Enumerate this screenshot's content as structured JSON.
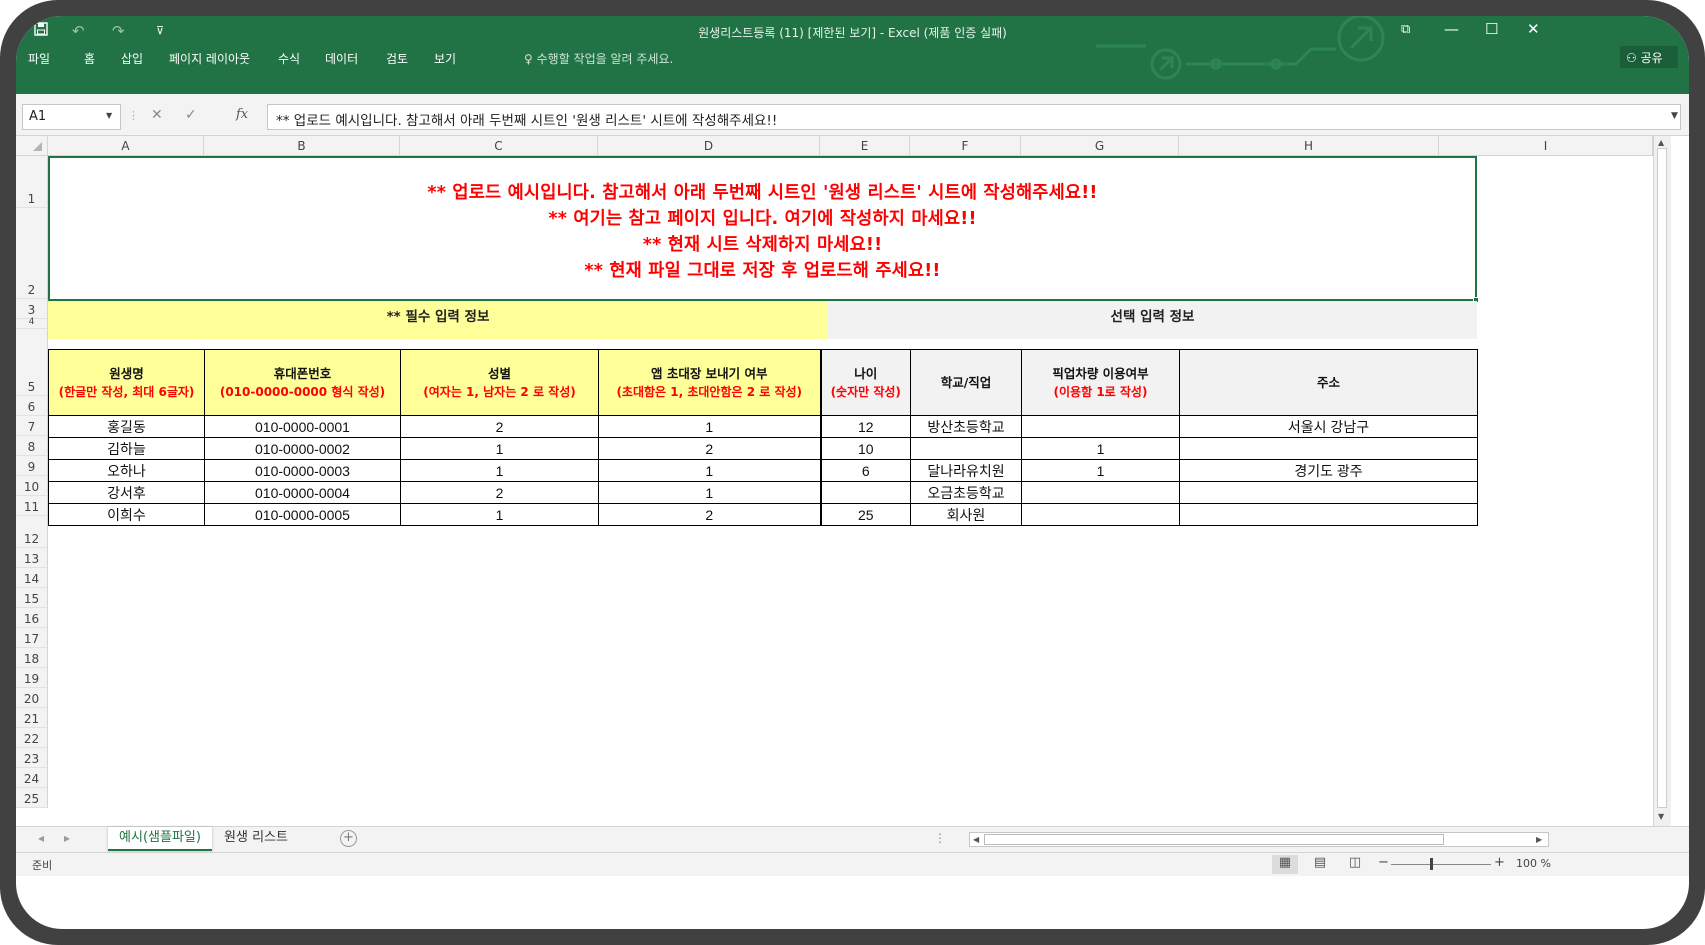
{
  "window": {
    "title": "원생리스트등록 (11)  [제한된 보기] - Excel (제품 인증 실패)",
    "qa_undo": "↶",
    "qa_redo": "↷",
    "qa_save_icon": "save-icon",
    "minimize": "—",
    "restore": "☐",
    "close": "✕",
    "ribbon_display": "⧉"
  },
  "menu": {
    "items": [
      "파일",
      "홈",
      "삽입",
      "페이지 레이아웃",
      "수식",
      "데이터",
      "검토",
      "보기"
    ],
    "tell_me": "수행할 작업을 알려 주세요.",
    "share": "공유"
  },
  "formula_bar": {
    "name_box": "A1",
    "cancel": "✕",
    "enter": "✓",
    "fx": "fx",
    "content": "** 업로드 예시입니다. 참고해서 아래 두번째 시트인 '원생 리스트' 시트에 작성해주세요!!"
  },
  "columns": [
    "A",
    "B",
    "C",
    "D",
    "E",
    "F",
    "G",
    "H",
    "I"
  ],
  "rows": [
    "1",
    "2",
    "3",
    "4",
    "5",
    "6",
    "7",
    "8",
    "9",
    "10",
    "11",
    "12",
    "13",
    "14",
    "15",
    "16",
    "17",
    "18",
    "19",
    "20",
    "21",
    "22",
    "23",
    "24",
    "25"
  ],
  "notice": {
    "line1": "** 업로드 예시입니다. 참고해서 아래 두번째 시트인 '원생 리스트' 시트에 작성해주세요!!",
    "line2": "** 여기는 참고 페이지 입니다. 여기에 작성하지 마세요!!",
    "line3": "** 현재 시트 삭제하지 마세요!!",
    "line4": "** 현재 파일 그대로 저장 후 업로드해 주세요!!"
  },
  "sections": {
    "required": "** 필수 입력 정보",
    "optional": "선택 입력 정보"
  },
  "headers": [
    {
      "title": "원생명",
      "sub": "(한글만 작성, 최대 6글자)"
    },
    {
      "title": "휴대폰번호",
      "sub": "(010-0000-0000 형식 작성)"
    },
    {
      "title": "성별",
      "sub": "(여자는 1, 남자는 2 로 작성)"
    },
    {
      "title": "앱 초대장 보내기 여부",
      "sub": "(초대함은 1, 초대안함은 2 로 작성)"
    },
    {
      "title": "나이",
      "sub": "(숫자만 작성)"
    },
    {
      "title": "학교/직업",
      "sub": ""
    },
    {
      "title": "픽업차량 이용여부",
      "sub": "(이용함 1로 작성)"
    },
    {
      "title": "주소",
      "sub": ""
    }
  ],
  "table_rows": [
    [
      "홍길동",
      "010-0000-0001",
      "2",
      "1",
      "12",
      "방산초등학교",
      "",
      "서울시 강남구"
    ],
    [
      "김하늘",
      "010-0000-0002",
      "1",
      "2",
      "10",
      "",
      "1",
      ""
    ],
    [
      "오하나",
      "010-0000-0003",
      "1",
      "1",
      "6",
      "달나라유치원",
      "1",
      "경기도 광주"
    ],
    [
      "강서후",
      "010-0000-0004",
      "2",
      "1",
      "",
      "오금초등학교",
      "",
      ""
    ],
    [
      "이희수",
      "010-0000-0005",
      "1",
      "2",
      "25",
      "회사원",
      "",
      ""
    ]
  ],
  "tabs": {
    "sheet1": "예시(샘플파일)",
    "sheet2": "원생 리스트",
    "add": "+"
  },
  "status": {
    "ready": "준비",
    "zoom": "100 %",
    "zoom_minus": "−",
    "zoom_plus": "+"
  },
  "colors": {
    "ribbon_green": "#217346",
    "notice_red": "#ff0000",
    "required_yellow": "#ffff99",
    "optional_gray": "#f2f2f2"
  }
}
